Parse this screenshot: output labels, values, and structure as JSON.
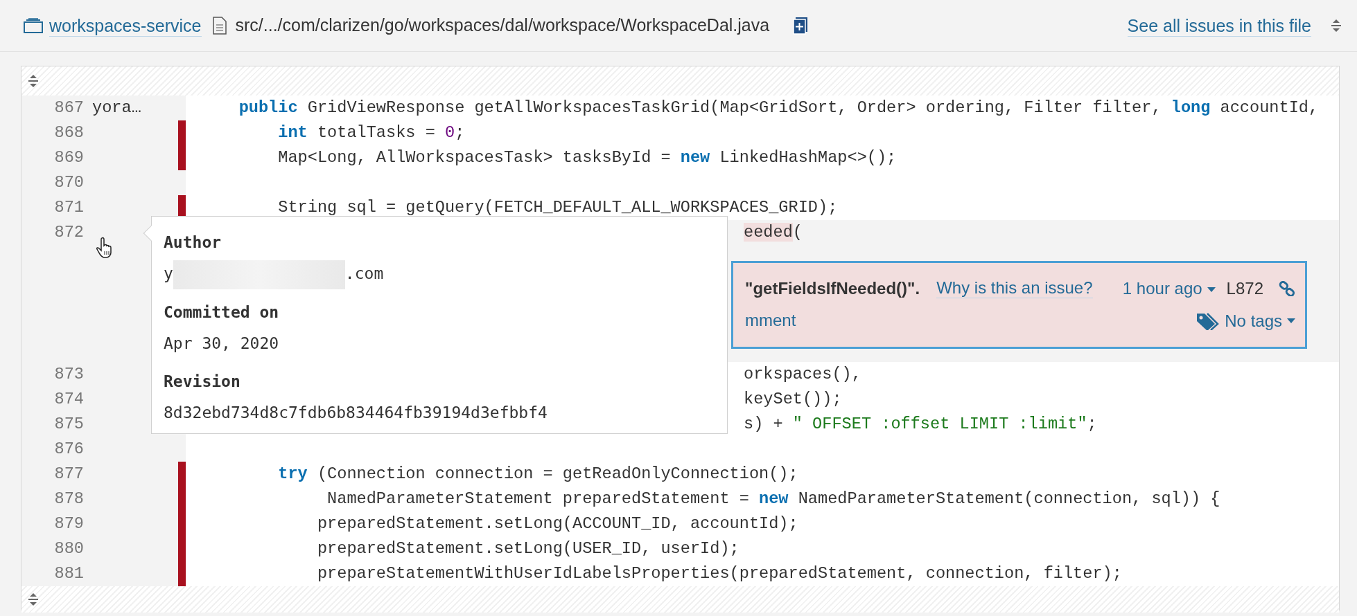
{
  "header": {
    "project": "workspaces-service",
    "file_path": "src/.../com/clarizen/go/workspaces/dal/workspace/WorkspaceDal.java",
    "issues_link": "See all issues in this file"
  },
  "code": {
    "lines": [
      {
        "number": "867",
        "author": "yora…",
        "changed": false,
        "selected": false,
        "kind": "full",
        "tokens": [
          {
            "text": "    public",
            "kind": "keyword"
          },
          {
            "text": " GridViewResponse getAllWorkspacesTaskGrid(Map<GridSort, Order> ordering, Filter filter, ",
            "kind": "plain"
          },
          {
            "text": "long",
            "kind": "keyword"
          },
          {
            "text": " accountId,",
            "kind": "plain"
          }
        ]
      },
      {
        "number": "868",
        "changed": true,
        "selected": false,
        "kind": "full",
        "tokens": [
          {
            "text": "        int",
            "kind": "keyword"
          },
          {
            "text": " totalTasks = ",
            "kind": "plain"
          },
          {
            "text": "0",
            "kind": "number"
          },
          {
            "text": ";",
            "kind": "plain"
          }
        ]
      },
      {
        "number": "869",
        "changed": true,
        "selected": false,
        "kind": "full",
        "tokens": [
          {
            "text": "        Map<Long, AllWorkspacesTask> tasksById = ",
            "kind": "plain"
          },
          {
            "text": "new",
            "kind": "keyword"
          },
          {
            "text": " LinkedHashMap<>();",
            "kind": "plain"
          }
        ]
      },
      {
        "number": "870",
        "changed": false,
        "selected": false,
        "kind": "full"
      },
      {
        "number": "871",
        "changed": true,
        "selected": false,
        "kind": "full",
        "tokens": [
          {
            "text": "        String sql = getQuery(FETCH_DEFAULT_ALL_WORKSPACES_GRID);",
            "kind": "plain"
          }
        ]
      },
      {
        "number": "872",
        "changed": false,
        "selected": true,
        "kind": "partial",
        "tokens": [
          {
            "text": "eeded",
            "kind": "issue"
          },
          {
            "text": "(",
            "kind": "plain"
          }
        ]
      },
      {
        "number": "873",
        "changed": false,
        "selected": false,
        "kind": "partial",
        "tokens": [
          {
            "text": "orkspaces(),",
            "kind": "plain"
          }
        ]
      },
      {
        "number": "874",
        "changed": false,
        "selected": false,
        "kind": "partial",
        "tokens": [
          {
            "text": "keySet());",
            "kind": "plain"
          }
        ]
      },
      {
        "number": "875",
        "changed": false,
        "selected": false,
        "kind": "partial",
        "tokens": [
          {
            "text": "s) + ",
            "kind": "plain"
          },
          {
            "text": "\" OFFSET :offset LIMIT :limit\"",
            "kind": "string"
          },
          {
            "text": ";",
            "kind": "plain"
          }
        ]
      },
      {
        "number": "876",
        "changed": false,
        "selected": false,
        "kind": "partial"
      },
      {
        "number": "877",
        "changed": true,
        "selected": false,
        "kind": "full",
        "tokens": [
          {
            "text": "        try",
            "kind": "keyword"
          },
          {
            "text": " (Connection connection = getReadOnlyConnection();",
            "kind": "plain"
          }
        ]
      },
      {
        "number": "878",
        "changed": true,
        "selected": false,
        "kind": "full",
        "tokens": [
          {
            "text": "             NamedParameterStatement preparedStatement = ",
            "kind": "plain"
          },
          {
            "text": "new",
            "kind": "keyword"
          },
          {
            "text": " NamedParameterStatement(connection, sql)) {",
            "kind": "plain"
          }
        ]
      },
      {
        "number": "879",
        "changed": true,
        "selected": false,
        "kind": "full",
        "tokens": [
          {
            "text": "            preparedStatement.setLong(ACCOUNT_ID, accountId);",
            "kind": "plain"
          }
        ]
      },
      {
        "number": "880",
        "changed": true,
        "selected": false,
        "kind": "full",
        "tokens": [
          {
            "text": "            preparedStatement.setLong(USER_ID, userId);",
            "kind": "plain"
          }
        ]
      },
      {
        "number": "881",
        "changed": true,
        "selected": false,
        "kind": "full",
        "tokens": [
          {
            "text": "            prepareStatementWithUserIdLabelsProperties(preparedStatement, connection, filter);",
            "kind": "plain"
          }
        ]
      }
    ]
  },
  "issue": {
    "message_fragment": "\"getFieldsIfNeeded()\".",
    "why_link": "Why is this an issue?",
    "age": "1 hour ago",
    "line": "L872",
    "comment_link": "mment",
    "tags": "No tags"
  },
  "blame_popup": {
    "author_label": "Author",
    "author_start": "y",
    "author_end": ".com",
    "committed_label": "Committed on",
    "committed_date": "Apr 30, 2020",
    "revision_label": "Revision",
    "revision": "8d32ebd734d8c7fdb6b834464fb39194d3efbbf4"
  }
}
